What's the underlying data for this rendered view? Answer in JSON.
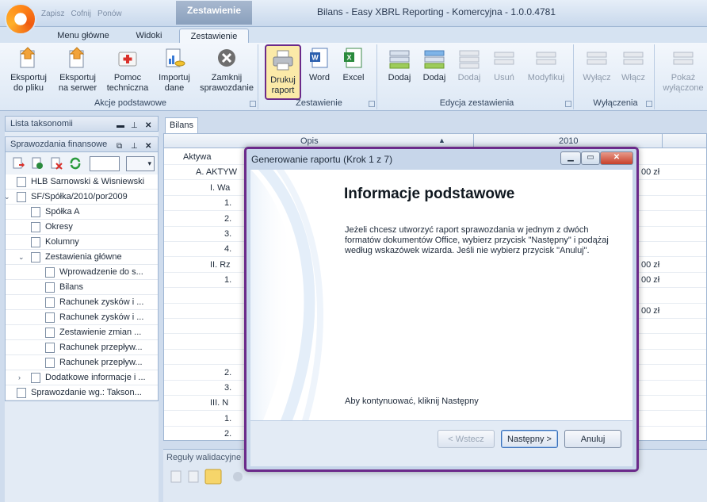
{
  "window": {
    "title": "Bilans - Easy XBRL Reporting - Komercyjna - 1.0.0.4781",
    "context_tab_title": "Zestawienie",
    "qat_labels": [
      "Zapisz",
      "Cofnij",
      "Ponów"
    ]
  },
  "ribbon": {
    "tabs": [
      "Menu główne",
      "Widoki",
      "Zestawienie"
    ],
    "active_tab": "Zestawienie",
    "groups": [
      {
        "label": "Akcje podstawowe",
        "buttons": [
          "Eksportuj do pliku",
          "Eksportuj na serwer",
          "Pomoc techniczna",
          "Importuj dane",
          "Zamknij sprawozdanie"
        ]
      },
      {
        "label": "Zestawienie",
        "buttons": [
          "Drukuj raport",
          "Word",
          "Excel"
        ]
      },
      {
        "label": "Edycja zestawienia",
        "buttons": [
          "Dodaj",
          "Dodaj",
          "Dodaj",
          "Usuń",
          "Modyfikuj"
        ]
      },
      {
        "label": "Wyłączenia",
        "buttons": [
          "Wyłącz",
          "Włącz"
        ]
      },
      {
        "label": "",
        "buttons": [
          "Pokaż wyłączone"
        ]
      }
    ],
    "highlighted_button": "Drukuj raport",
    "brand_highlight_color": "#6b2a8a"
  },
  "left_panel": {
    "taxonomy_title": "Lista taksonomii",
    "reports_title": "Sprawozdania finansowe",
    "tree": [
      {
        "label": "HLB Sarnowski & Wisniewski",
        "level": 0
      },
      {
        "label": "SF/Spółka/2010/por2009",
        "level": 0,
        "expanded": true
      },
      {
        "label": "Spółka A",
        "level": 1
      },
      {
        "label": "Okresy",
        "level": 1
      },
      {
        "label": "Kolumny",
        "level": 1
      },
      {
        "label": "Zestawienia główne",
        "level": 1,
        "expanded": true
      },
      {
        "label": "Wprowadzenie do s...",
        "level": 2
      },
      {
        "label": "Bilans",
        "level": 2
      },
      {
        "label": "Rachunek zysków i ...",
        "level": 2
      },
      {
        "label": "Rachunek zysków i ...",
        "level": 2
      },
      {
        "label": "Zestawienie zmian ...",
        "level": 2
      },
      {
        "label": "Rachunek przepływ...",
        "level": 2
      },
      {
        "label": "Rachunek przepływ...",
        "level": 2
      },
      {
        "label": "Dodatkowe informacje i ...",
        "level": 1
      },
      {
        "label": "Sprawozdanie wg.: Takson...",
        "level": 0
      }
    ]
  },
  "document": {
    "tab": "Bilans",
    "columns": {
      "opis": "Opis",
      "year": "2010"
    },
    "rows": [
      {
        "label": "Aktywa",
        "value": ""
      },
      {
        "label": "A. AKTYW",
        "value": "00 zł"
      },
      {
        "label": "I. Wa",
        "value": ""
      },
      {
        "label": "1.",
        "value": ""
      },
      {
        "label": "2.",
        "value": ""
      },
      {
        "label": "3.",
        "value": ""
      },
      {
        "label": "4.",
        "value": ""
      },
      {
        "label": "II. Rz",
        "value": "00 zł"
      },
      {
        "label": "1.",
        "value": "00 zł"
      },
      {
        "label": "",
        "value": ""
      },
      {
        "label": "",
        "value": "00 zł"
      },
      {
        "label": "",
        "value": ""
      },
      {
        "label": "",
        "value": ""
      },
      {
        "label": "",
        "value": ""
      },
      {
        "label": "2.",
        "value": ""
      },
      {
        "label": "3.",
        "value": ""
      },
      {
        "label": "III. N",
        "value": ""
      },
      {
        "label": "1.",
        "value": ""
      },
      {
        "label": "2.",
        "value": ""
      }
    ],
    "validation_title": "Reguły walidacyjne"
  },
  "dialog": {
    "title": "Generowanie raportu (Krok 1 z 7)",
    "heading": "Informacje podstawowe",
    "body": "Jeżeli chcesz utworzyć raport sprawozdania w jednym z dwóch formatów dokumentów Office, wybierz przycisk \"Następny\" i podążaj według wskazówek wizarda. Jeśli nie wybierz przycisk \"Anuluj\".",
    "footer_hint": "Aby kontynuować, kliknij Następny",
    "buttons": {
      "back": "< Wstecz",
      "next": "Następny >",
      "cancel": "Anuluj"
    }
  }
}
